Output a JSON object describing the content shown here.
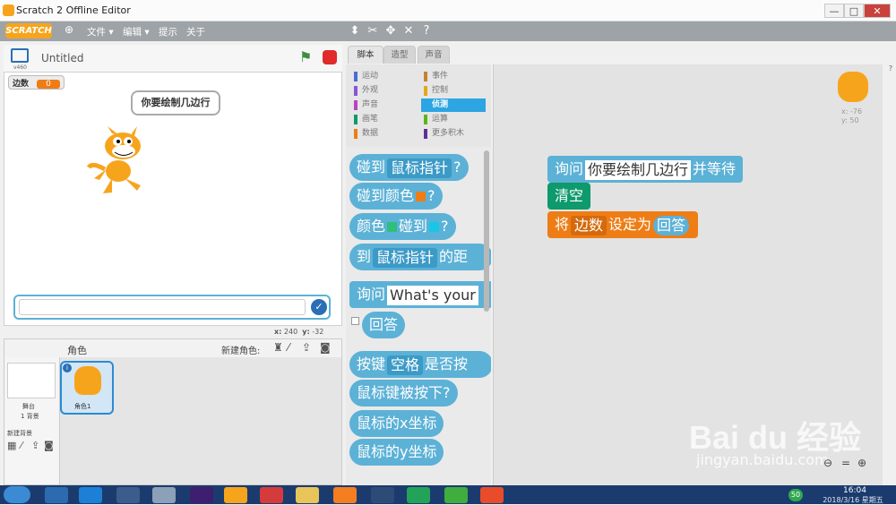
{
  "window": {
    "title": "Scratch 2 Offline Editor",
    "buttons": [
      "—",
      "□",
      "✕"
    ]
  },
  "menubar": {
    "logo": "SCRATCH",
    "items": [
      "文件 ▾",
      "编辑 ▾",
      "提示",
      "关于"
    ],
    "tools": [
      "duplicate-icon",
      "delete-icon",
      "grow-icon",
      "shrink-icon",
      "help-icon"
    ]
  },
  "stage": {
    "project_title": "Untitled",
    "version": "v460",
    "variable_monitor": {
      "name": "边数",
      "value": "0"
    },
    "speech_bubble": "你要绘制几边行",
    "coords": {
      "x_label": "x:",
      "x": "240",
      "y_label": "y:",
      "y": "-32"
    }
  },
  "sprites_pane": {
    "title": "角色",
    "new_sprite_label": "新建角色:",
    "stage_label": "舞台",
    "stage_backdrops": "1 背景",
    "new_backdrop_label": "新建背景",
    "sprite_name": "角色1"
  },
  "tabs": [
    "脚本",
    "造型",
    "声音"
  ],
  "categories": {
    "left": [
      {
        "label": "运动",
        "color": "#4a6cd4"
      },
      {
        "label": "外观",
        "color": "#8a55d7"
      },
      {
        "label": "声音",
        "color": "#bb42c3"
      },
      {
        "label": "画笔",
        "color": "#0e9a6c"
      },
      {
        "label": "数据",
        "color": "#ee7d16"
      }
    ],
    "right": [
      {
        "label": "事件",
        "color": "#c88330"
      },
      {
        "label": "控制",
        "color": "#e1a91a"
      },
      {
        "label": "侦测",
        "color": "#2ca5e2"
      },
      {
        "label": "运算",
        "color": "#5cb712"
      },
      {
        "label": "更多积木",
        "color": "#632d99"
      }
    ],
    "selected": "侦测"
  },
  "palette": {
    "b1_a": "碰到",
    "b1_slot": "鼠标指针",
    "b1_b": "?",
    "b2_a": "碰到颜色",
    "b2_b": "?",
    "b3_a": "颜色",
    "b3_b": "碰到",
    "b3_c": "?",
    "b4_a": "到",
    "b4_slot": "鼠标指针",
    "b4_b": "的距",
    "b5_a": "询问",
    "b5_text": "What's your",
    "b6": "回答",
    "b7_a": "按键",
    "b7_slot": "空格",
    "b7_b": "是否按",
    "b8": "鼠标键被按下?",
    "b9": "鼠标的x坐标",
    "b10": "鼠标的y坐标"
  },
  "script": {
    "ask_label": "询问",
    "ask_text": "你要绘制几边行",
    "ask_suffix": "并等待",
    "clear_label": "清空",
    "set_label": "将",
    "set_var": "边数",
    "set_mid": "设定为",
    "set_value": "回答"
  },
  "sprite_info": {
    "x": "x: -76",
    "y": "y: 50"
  },
  "watermark": {
    "brand": "Bai du 经验",
    "url": "jingyan.baidu.com"
  },
  "taskbar": {
    "time": "16:04",
    "date": "2018/3/16 星期五",
    "badge": "50"
  },
  "colors": {
    "sensing": "#5cb1d6",
    "sensing_dark": "#3c9ac7",
    "data": "#ee7d16",
    "pen": "#0e9a6c"
  }
}
